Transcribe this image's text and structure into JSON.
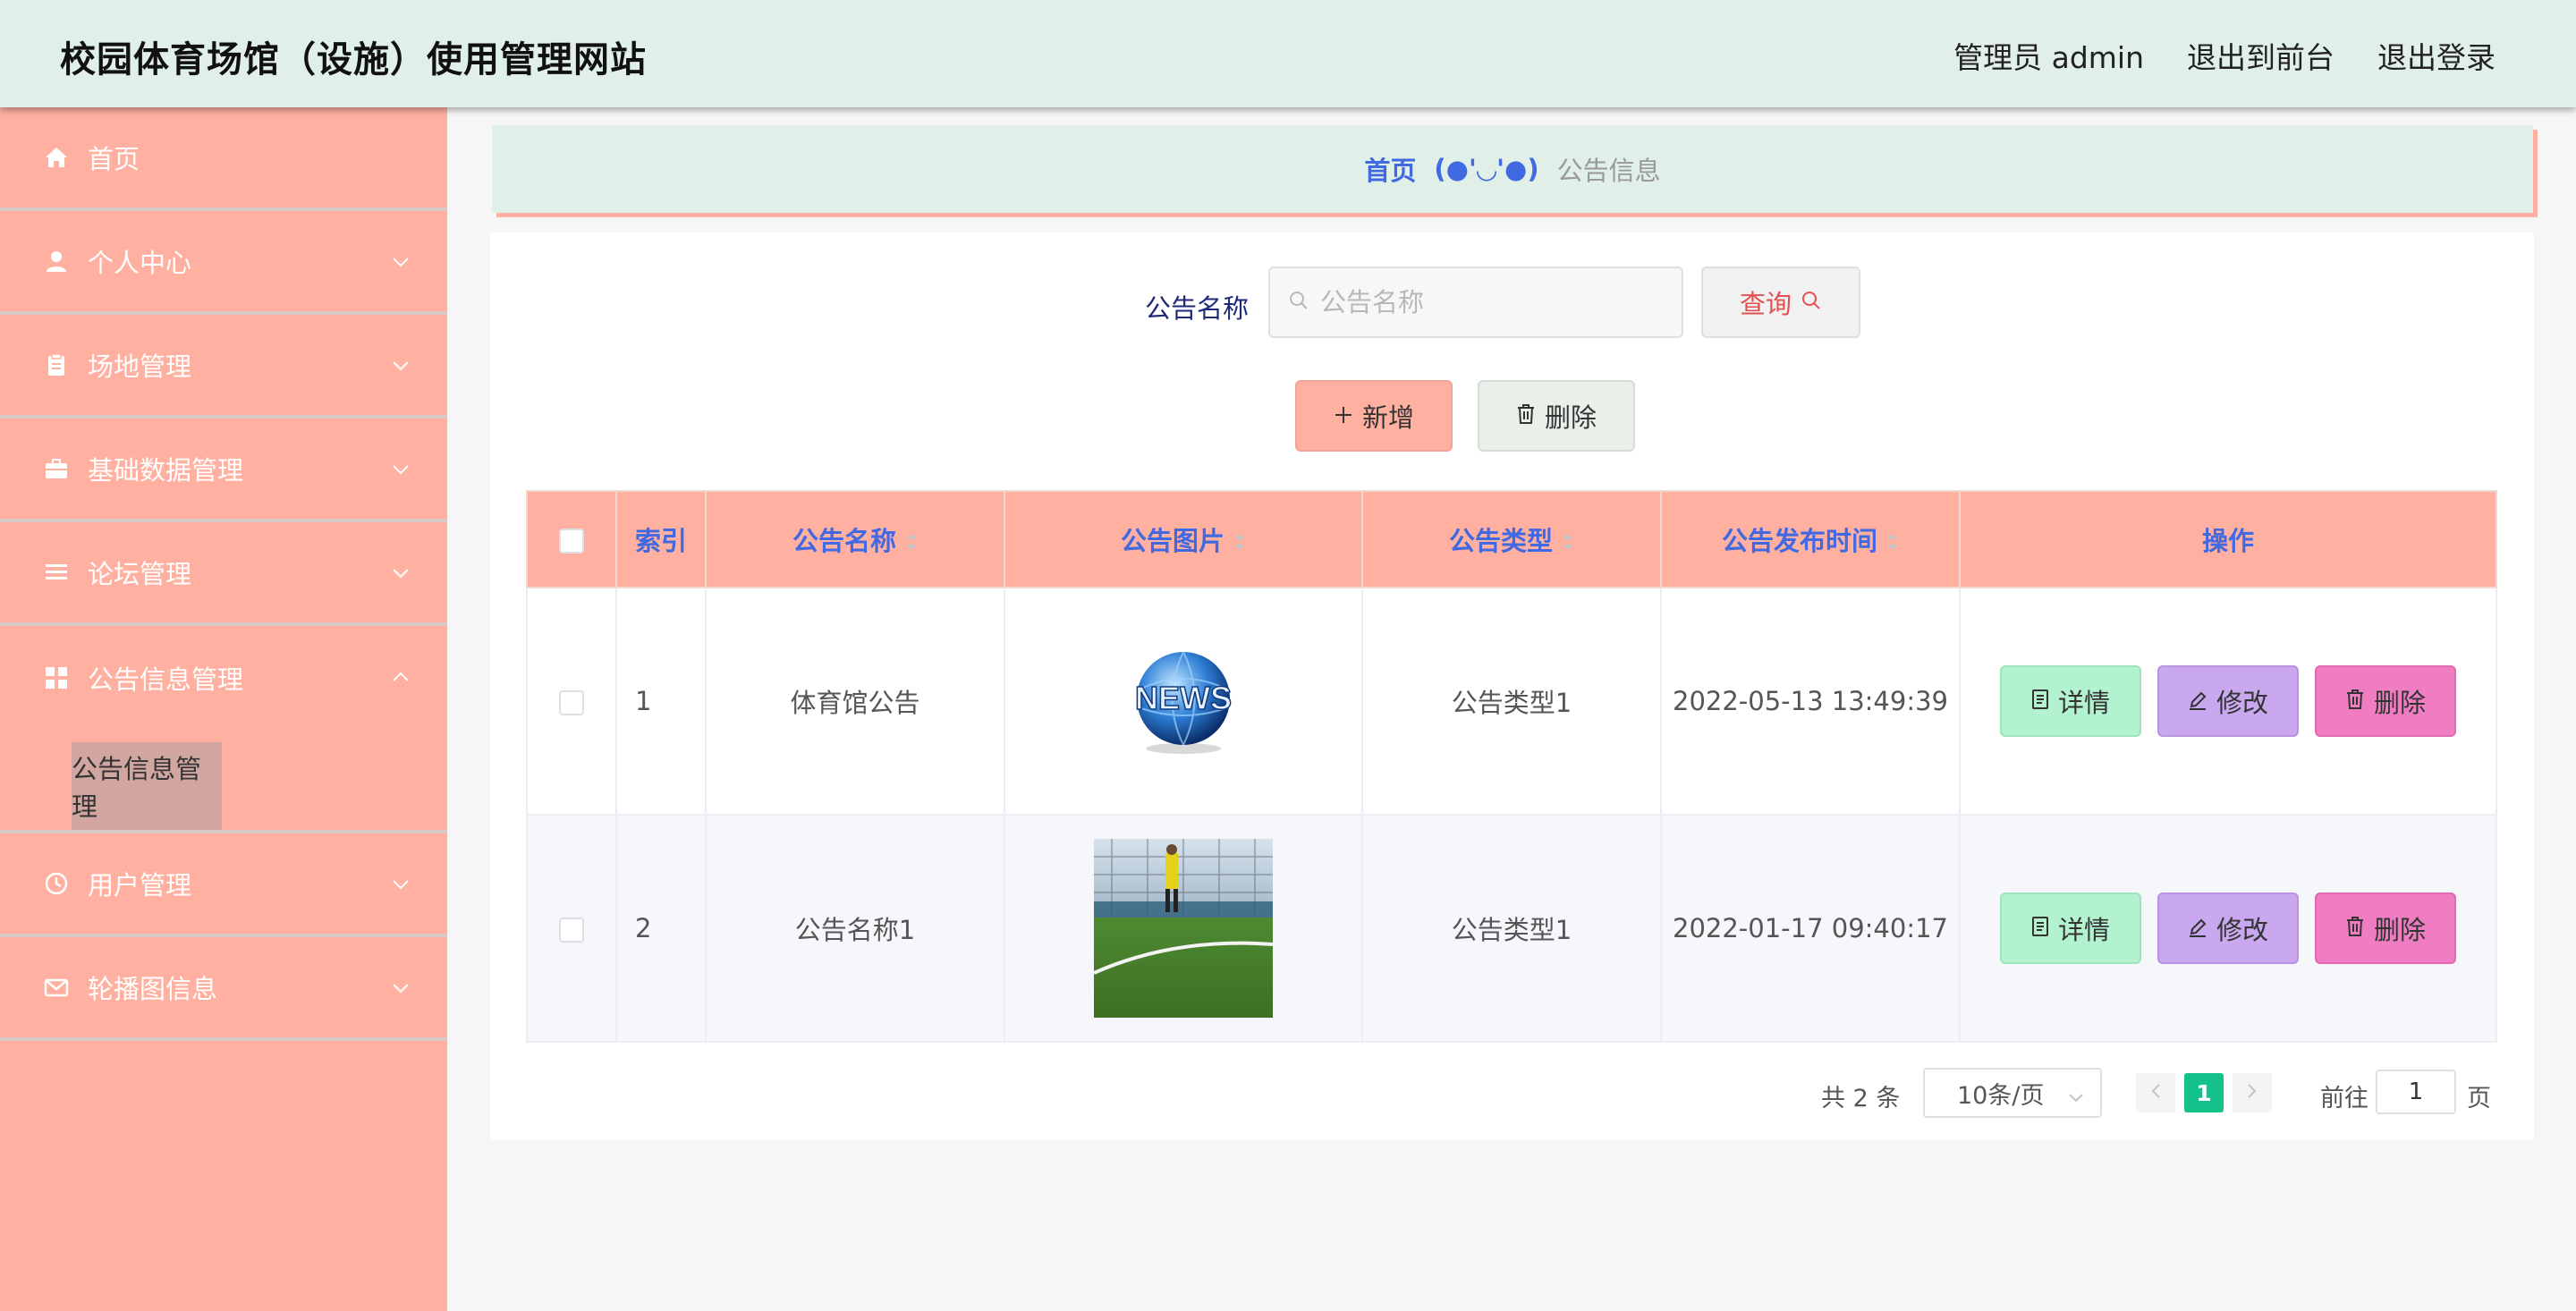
{
  "header": {
    "title": "校园体育场馆（设施）使用管理网站",
    "links": [
      "管理员 admin",
      "退出到前台",
      "退出登录"
    ]
  },
  "sidebar": {
    "items": [
      {
        "label": "首页",
        "icon": "home-icon"
      },
      {
        "label": "个人中心",
        "icon": "user-icon"
      },
      {
        "label": "场地管理",
        "icon": "clipboard-icon"
      },
      {
        "label": "基础数据管理",
        "icon": "briefcase-icon"
      },
      {
        "label": "论坛管理",
        "icon": "list-icon"
      },
      {
        "label": "公告信息管理",
        "icon": "grid-icon",
        "expanded": true
      },
      {
        "label": "用户管理",
        "icon": "clock-icon"
      },
      {
        "label": "轮播图信息",
        "icon": "mail-icon"
      }
    ],
    "submenu": {
      "label": "公告信息管理"
    }
  },
  "breadcrumb": {
    "home": "首页",
    "separator": "(●'◡'●)",
    "current": "公告信息"
  },
  "search": {
    "label": "公告名称",
    "placeholder": "公告名称",
    "button": "查询"
  },
  "actions": {
    "add": "新增",
    "delete": "删除"
  },
  "table": {
    "columns": [
      "索引",
      "公告名称",
      "公告图片",
      "公告类型",
      "公告发布时间",
      "操作"
    ],
    "rows": [
      {
        "index": "1",
        "name": "体育馆公告",
        "type": "公告类型1",
        "time": "2022-05-13 13:49:39",
        "image": "news-globe-image"
      },
      {
        "index": "2",
        "name": "公告名称1",
        "type": "公告类型1",
        "time": "2022-01-17 09:40:17",
        "image": "soccer-field-image"
      }
    ],
    "row_actions": {
      "detail": "详情",
      "edit": "修改",
      "delete": "删除"
    }
  },
  "pagination": {
    "total": "共 2 条",
    "page_size": "10条/页",
    "current": "1",
    "goto_label": "前往",
    "goto_value": "1",
    "page_suffix": "页"
  },
  "colors": {
    "header_bg": "#e0efe7",
    "sidebar_bg": "#ffb0a0",
    "accent_blue": "#4169e1",
    "pager_active": "#13c28a"
  }
}
